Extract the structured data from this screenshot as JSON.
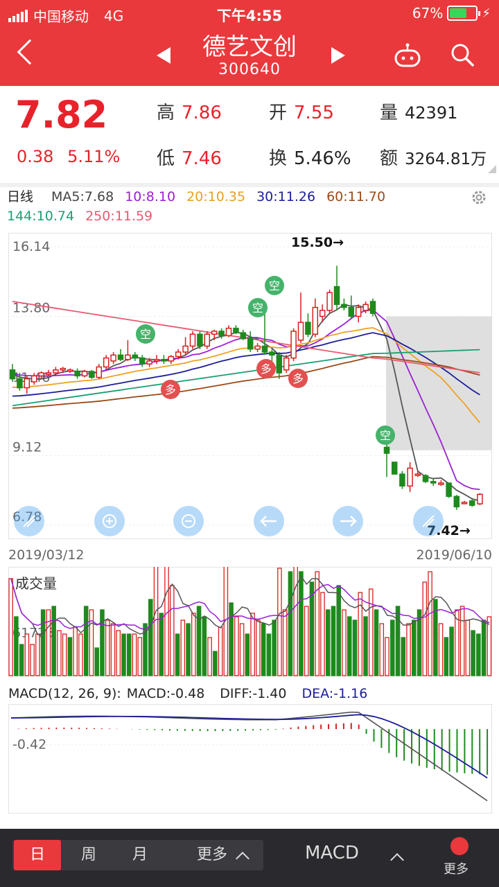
{
  "status_bar": {
    "carrier": "中国移动",
    "network": "4G",
    "time": "下午4:55",
    "battery": "67%",
    "battery_level": 0.67
  },
  "header": {
    "name": "德艺文创",
    "code": "300640"
  },
  "quote": {
    "price": "7.82",
    "change": "0.38",
    "change_pct": "5.11%",
    "high_label": "高",
    "high": "7.86",
    "low_label": "低",
    "low": "7.46",
    "open_label": "开",
    "open": "7.55",
    "turnover_label": "换",
    "turnover": "5.46%",
    "volume_label": "量",
    "volume": "42391",
    "amount_label": "额",
    "amount": "3264.81万"
  },
  "ma_legend": {
    "period": "日线",
    "ma5": "MA5:7.68",
    "ma10": "10:8.10",
    "ma20": "20:10.35",
    "ma30": "30:11.26",
    "ma60": "60:11.70",
    "ma144": "144:10.74",
    "ma250": "250:11.59"
  },
  "colors": {
    "accent": "#e9393c",
    "up": "#d81e1e",
    "down": "#1e8a1e",
    "ma5": "#555555",
    "ma10": "#9b1fd6",
    "ma20": "#f0a020",
    "ma30": "#1c1c9a",
    "ma60": "#9a4a18",
    "ma144": "#18a070",
    "ma250": "#e85a70"
  },
  "chart_data": [
    {
      "type": "candlestick",
      "y_ticks": [
        "16.14",
        "13.80",
        "11.46",
        "9.12",
        "6.78"
      ],
      "ylim": [
        6.78,
        16.14
      ],
      "x_start": "2019/03/12",
      "x_end": "2019/06/10",
      "max_label": "15.50→",
      "min_label": "7.42→",
      "markers": [
        "空",
        "空",
        "空",
        "多",
        "多",
        "多",
        "空"
      ],
      "candles": [
        {
          "o": 12.0,
          "h": 12.2,
          "l": 11.6,
          "c": 11.7
        },
        {
          "o": 11.7,
          "h": 11.9,
          "l": 11.3,
          "c": 11.4
        },
        {
          "o": 11.4,
          "h": 11.8,
          "l": 11.2,
          "c": 11.7
        },
        {
          "o": 11.6,
          "h": 11.9,
          "l": 11.5,
          "c": 11.8
        },
        {
          "o": 11.8,
          "h": 11.95,
          "l": 11.7,
          "c": 11.9
        },
        {
          "o": 11.85,
          "h": 12.0,
          "l": 11.8,
          "c": 11.9
        },
        {
          "o": 11.9,
          "h": 12.1,
          "l": 11.8,
          "c": 12.0
        },
        {
          "o": 12.0,
          "h": 12.1,
          "l": 11.9,
          "c": 12.05
        },
        {
          "o": 12.0,
          "h": 12.05,
          "l": 11.9,
          "c": 12.0
        },
        {
          "o": 11.95,
          "h": 12.05,
          "l": 11.7,
          "c": 11.8
        },
        {
          "o": 11.8,
          "h": 12.0,
          "l": 11.75,
          "c": 11.95
        },
        {
          "o": 11.95,
          "h": 12.0,
          "l": 11.7,
          "c": 11.75
        },
        {
          "o": 11.75,
          "h": 12.2,
          "l": 11.7,
          "c": 12.1
        },
        {
          "o": 12.1,
          "h": 12.5,
          "l": 12.0,
          "c": 12.4
        },
        {
          "o": 12.3,
          "h": 12.6,
          "l": 12.2,
          "c": 12.5
        },
        {
          "o": 12.5,
          "h": 12.7,
          "l": 12.3,
          "c": 12.35
        },
        {
          "o": 12.35,
          "h": 13.0,
          "l": 12.3,
          "c": 12.5
        },
        {
          "o": 12.5,
          "h": 12.6,
          "l": 12.3,
          "c": 12.4
        },
        {
          "o": 12.4,
          "h": 12.5,
          "l": 12.1,
          "c": 12.2
        },
        {
          "o": 12.2,
          "h": 12.4,
          "l": 12.1,
          "c": 12.3
        },
        {
          "o": 12.3,
          "h": 12.5,
          "l": 12.2,
          "c": 12.35
        },
        {
          "o": 12.35,
          "h": 12.5,
          "l": 12.2,
          "c": 12.3
        },
        {
          "o": 12.3,
          "h": 12.5,
          "l": 12.2,
          "c": 12.45
        },
        {
          "o": 12.45,
          "h": 12.7,
          "l": 12.35,
          "c": 12.6
        },
        {
          "o": 12.6,
          "h": 13.1,
          "l": 12.5,
          "c": 12.8
        },
        {
          "o": 12.8,
          "h": 13.3,
          "l": 12.7,
          "c": 13.2
        },
        {
          "o": 13.2,
          "h": 13.3,
          "l": 12.7,
          "c": 12.8
        },
        {
          "o": 12.8,
          "h": 13.3,
          "l": 12.7,
          "c": 13.2
        },
        {
          "o": 13.2,
          "h": 13.35,
          "l": 13.0,
          "c": 13.3
        },
        {
          "o": 13.3,
          "h": 13.4,
          "l": 13.05,
          "c": 13.15
        },
        {
          "o": 13.15,
          "h": 13.5,
          "l": 13.1,
          "c": 13.4
        },
        {
          "o": 13.4,
          "h": 13.5,
          "l": 13.2,
          "c": 13.25
        },
        {
          "o": 13.25,
          "h": 13.35,
          "l": 13.0,
          "c": 13.05
        },
        {
          "o": 13.05,
          "h": 13.3,
          "l": 12.6,
          "c": 12.7
        },
        {
          "o": 12.7,
          "h": 12.9,
          "l": 12.6,
          "c": 12.8
        },
        {
          "o": 12.8,
          "h": 14.2,
          "l": 12.5,
          "c": 12.6
        },
        {
          "o": 12.6,
          "h": 12.7,
          "l": 12.3,
          "c": 12.5
        },
        {
          "o": 12.5,
          "h": 12.6,
          "l": 11.7,
          "c": 11.9
        },
        {
          "o": 12.0,
          "h": 12.5,
          "l": 11.9,
          "c": 12.4
        },
        {
          "o": 12.4,
          "h": 13.4,
          "l": 12.3,
          "c": 13.3
        },
        {
          "o": 13.0,
          "h": 14.6,
          "l": 12.9,
          "c": 13.6
        },
        {
          "o": 13.6,
          "h": 13.9,
          "l": 13.1,
          "c": 13.2
        },
        {
          "o": 13.2,
          "h": 14.4,
          "l": 13.1,
          "c": 14.1
        },
        {
          "o": 13.8,
          "h": 14.2,
          "l": 13.6,
          "c": 14.0
        },
        {
          "o": 14.0,
          "h": 14.7,
          "l": 13.9,
          "c": 14.6
        },
        {
          "o": 14.8,
          "h": 15.5,
          "l": 14.0,
          "c": 14.2
        },
        {
          "o": 14.2,
          "h": 14.4,
          "l": 14.0,
          "c": 14.1
        },
        {
          "o": 14.1,
          "h": 14.5,
          "l": 13.7,
          "c": 13.8
        },
        {
          "o": 13.8,
          "h": 14.2,
          "l": 13.6,
          "c": 14.1
        },
        {
          "o": 14.0,
          "h": 14.3,
          "l": 13.9,
          "c": 14.2
        },
        {
          "o": 14.3,
          "h": 14.4,
          "l": 13.8,
          "c": 13.9
        },
        {
          "o": 9.4,
          "h": 9.6,
          "l": 8.4,
          "c": 9.2
        },
        {
          "o": 8.9,
          "h": 8.9,
          "l": 8.5,
          "c": 8.5
        },
        {
          "o": 8.5,
          "h": 8.6,
          "l": 8.0,
          "c": 8.1
        },
        {
          "o": 8.1,
          "h": 8.9,
          "l": 7.9,
          "c": 8.7
        },
        {
          "o": 8.5,
          "h": 8.6,
          "l": 8.4,
          "c": 8.5
        },
        {
          "o": 8.45,
          "h": 8.5,
          "l": 8.2,
          "c": 8.25
        },
        {
          "o": 8.25,
          "h": 8.35,
          "l": 8.1,
          "c": 8.2
        },
        {
          "o": 8.2,
          "h": 8.3,
          "l": 8.1,
          "c": 8.2
        },
        {
          "o": 8.2,
          "h": 8.2,
          "l": 7.7,
          "c": 7.75
        },
        {
          "o": 7.75,
          "h": 7.8,
          "l": 7.3,
          "c": 7.4
        },
        {
          "o": 7.55,
          "h": 7.6,
          "l": 7.5,
          "c": 7.55
        },
        {
          "o": 7.6,
          "h": 7.65,
          "l": 7.4,
          "c": 7.45
        },
        {
          "o": 7.5,
          "h": 7.86,
          "l": 7.46,
          "c": 7.82
        }
      ]
    },
    {
      "type": "bar",
      "title": "成交量",
      "y_ticks": [
        "61725"
      ],
      "ylim": [
        0,
        155000
      ],
      "values": [
        140000,
        85000,
        45000,
        60000,
        45000,
        60000,
        95000,
        95000,
        100000,
        65000,
        60000,
        55000,
        70000,
        60000,
        100000,
        95000,
        40000,
        95000,
        80000,
        75000,
        65000,
        60000,
        60000,
        60000,
        55000,
        75000,
        110000,
        170000,
        90000,
        160000,
        130000,
        60000,
        80000,
        75000,
        90000,
        100000,
        85000,
        55000,
        35000,
        70000,
        160000,
        105000,
        85000,
        75000,
        60000,
        90000,
        80000,
        75000,
        60000,
        80000,
        155000,
        95000,
        150000,
        165000,
        150000,
        100000,
        135000,
        150000,
        120000,
        95000,
        100000,
        130000,
        95000,
        85000,
        80000,
        120000,
        85000,
        125000,
        95000,
        75000,
        55000,
        80000,
        100000,
        55000,
        75000,
        80000,
        95000,
        135000,
        150000,
        110000,
        75000,
        55000,
        70000,
        95000,
        100000,
        80000,
        65000,
        60000,
        80000,
        85000
      ],
      "up": [
        true,
        false,
        false,
        true,
        true,
        true,
        false,
        true,
        false,
        true,
        true,
        false,
        true,
        true,
        false,
        true,
        false,
        false,
        true,
        true,
        true,
        false,
        false,
        true,
        true,
        false,
        false,
        true,
        false,
        true,
        true,
        false,
        true,
        false,
        true,
        false,
        false,
        true,
        false,
        true,
        true,
        false,
        true,
        true,
        false,
        true,
        true,
        false,
        false,
        false,
        true,
        true,
        false,
        true,
        false,
        true,
        false,
        true,
        true,
        false,
        false,
        false,
        true,
        false,
        false,
        true,
        false,
        true,
        false,
        true,
        true,
        false,
        false,
        false,
        true,
        false,
        false,
        true,
        true,
        false,
        true,
        false,
        false,
        true,
        true,
        true,
        false,
        false,
        false,
        true
      ]
    },
    {
      "type": "bar",
      "title": "MACD(12, 26, 9):",
      "series_labels": [
        "MACD:-0.48",
        "DIFF:-1.40",
        "DEA:-1.16"
      ],
      "y_ticks": [
        "-0.42"
      ],
      "ylim": [
        -2.2,
        0.6
      ]
    }
  ],
  "toolbar": {
    "day": "日",
    "week": "周",
    "month": "月",
    "more1": "更多",
    "indicator": "MACD",
    "more2": "更多"
  }
}
